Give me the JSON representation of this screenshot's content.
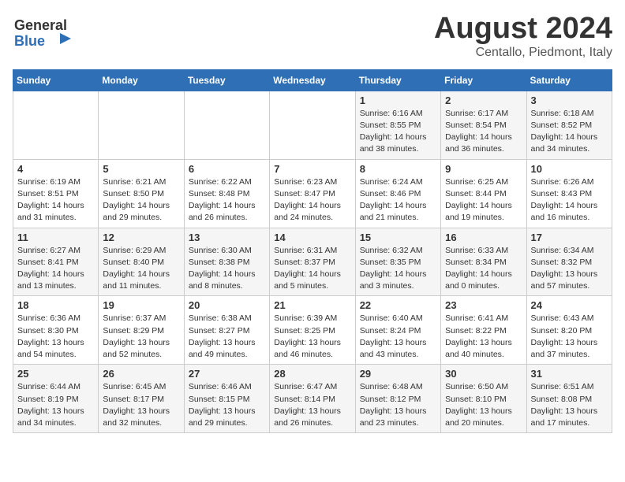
{
  "header": {
    "logo_general": "General",
    "logo_blue": "Blue",
    "title": "August 2024",
    "subtitle": "Centallo, Piedmont, Italy"
  },
  "days_of_week": [
    "Sunday",
    "Monday",
    "Tuesday",
    "Wednesday",
    "Thursday",
    "Friday",
    "Saturday"
  ],
  "weeks": [
    [
      {
        "day": "",
        "info": ""
      },
      {
        "day": "",
        "info": ""
      },
      {
        "day": "",
        "info": ""
      },
      {
        "day": "",
        "info": ""
      },
      {
        "day": "1",
        "info": "Sunrise: 6:16 AM\nSunset: 8:55 PM\nDaylight: 14 hours\nand 38 minutes."
      },
      {
        "day": "2",
        "info": "Sunrise: 6:17 AM\nSunset: 8:54 PM\nDaylight: 14 hours\nand 36 minutes."
      },
      {
        "day": "3",
        "info": "Sunrise: 6:18 AM\nSunset: 8:52 PM\nDaylight: 14 hours\nand 34 minutes."
      }
    ],
    [
      {
        "day": "4",
        "info": "Sunrise: 6:19 AM\nSunset: 8:51 PM\nDaylight: 14 hours\nand 31 minutes."
      },
      {
        "day": "5",
        "info": "Sunrise: 6:21 AM\nSunset: 8:50 PM\nDaylight: 14 hours\nand 29 minutes."
      },
      {
        "day": "6",
        "info": "Sunrise: 6:22 AM\nSunset: 8:48 PM\nDaylight: 14 hours\nand 26 minutes."
      },
      {
        "day": "7",
        "info": "Sunrise: 6:23 AM\nSunset: 8:47 PM\nDaylight: 14 hours\nand 24 minutes."
      },
      {
        "day": "8",
        "info": "Sunrise: 6:24 AM\nSunset: 8:46 PM\nDaylight: 14 hours\nand 21 minutes."
      },
      {
        "day": "9",
        "info": "Sunrise: 6:25 AM\nSunset: 8:44 PM\nDaylight: 14 hours\nand 19 minutes."
      },
      {
        "day": "10",
        "info": "Sunrise: 6:26 AM\nSunset: 8:43 PM\nDaylight: 14 hours\nand 16 minutes."
      }
    ],
    [
      {
        "day": "11",
        "info": "Sunrise: 6:27 AM\nSunset: 8:41 PM\nDaylight: 14 hours\nand 13 minutes."
      },
      {
        "day": "12",
        "info": "Sunrise: 6:29 AM\nSunset: 8:40 PM\nDaylight: 14 hours\nand 11 minutes."
      },
      {
        "day": "13",
        "info": "Sunrise: 6:30 AM\nSunset: 8:38 PM\nDaylight: 14 hours\nand 8 minutes."
      },
      {
        "day": "14",
        "info": "Sunrise: 6:31 AM\nSunset: 8:37 PM\nDaylight: 14 hours\nand 5 minutes."
      },
      {
        "day": "15",
        "info": "Sunrise: 6:32 AM\nSunset: 8:35 PM\nDaylight: 14 hours\nand 3 minutes."
      },
      {
        "day": "16",
        "info": "Sunrise: 6:33 AM\nSunset: 8:34 PM\nDaylight: 14 hours\nand 0 minutes."
      },
      {
        "day": "17",
        "info": "Sunrise: 6:34 AM\nSunset: 8:32 PM\nDaylight: 13 hours\nand 57 minutes."
      }
    ],
    [
      {
        "day": "18",
        "info": "Sunrise: 6:36 AM\nSunset: 8:30 PM\nDaylight: 13 hours\nand 54 minutes."
      },
      {
        "day": "19",
        "info": "Sunrise: 6:37 AM\nSunset: 8:29 PM\nDaylight: 13 hours\nand 52 minutes."
      },
      {
        "day": "20",
        "info": "Sunrise: 6:38 AM\nSunset: 8:27 PM\nDaylight: 13 hours\nand 49 minutes."
      },
      {
        "day": "21",
        "info": "Sunrise: 6:39 AM\nSunset: 8:25 PM\nDaylight: 13 hours\nand 46 minutes."
      },
      {
        "day": "22",
        "info": "Sunrise: 6:40 AM\nSunset: 8:24 PM\nDaylight: 13 hours\nand 43 minutes."
      },
      {
        "day": "23",
        "info": "Sunrise: 6:41 AM\nSunset: 8:22 PM\nDaylight: 13 hours\nand 40 minutes."
      },
      {
        "day": "24",
        "info": "Sunrise: 6:43 AM\nSunset: 8:20 PM\nDaylight: 13 hours\nand 37 minutes."
      }
    ],
    [
      {
        "day": "25",
        "info": "Sunrise: 6:44 AM\nSunset: 8:19 PM\nDaylight: 13 hours\nand 34 minutes."
      },
      {
        "day": "26",
        "info": "Sunrise: 6:45 AM\nSunset: 8:17 PM\nDaylight: 13 hours\nand 32 minutes."
      },
      {
        "day": "27",
        "info": "Sunrise: 6:46 AM\nSunset: 8:15 PM\nDaylight: 13 hours\nand 29 minutes."
      },
      {
        "day": "28",
        "info": "Sunrise: 6:47 AM\nSunset: 8:14 PM\nDaylight: 13 hours\nand 26 minutes."
      },
      {
        "day": "29",
        "info": "Sunrise: 6:48 AM\nSunset: 8:12 PM\nDaylight: 13 hours\nand 23 minutes."
      },
      {
        "day": "30",
        "info": "Sunrise: 6:50 AM\nSunset: 8:10 PM\nDaylight: 13 hours\nand 20 minutes."
      },
      {
        "day": "31",
        "info": "Sunrise: 6:51 AM\nSunset: 8:08 PM\nDaylight: 13 hours\nand 17 minutes."
      }
    ]
  ]
}
